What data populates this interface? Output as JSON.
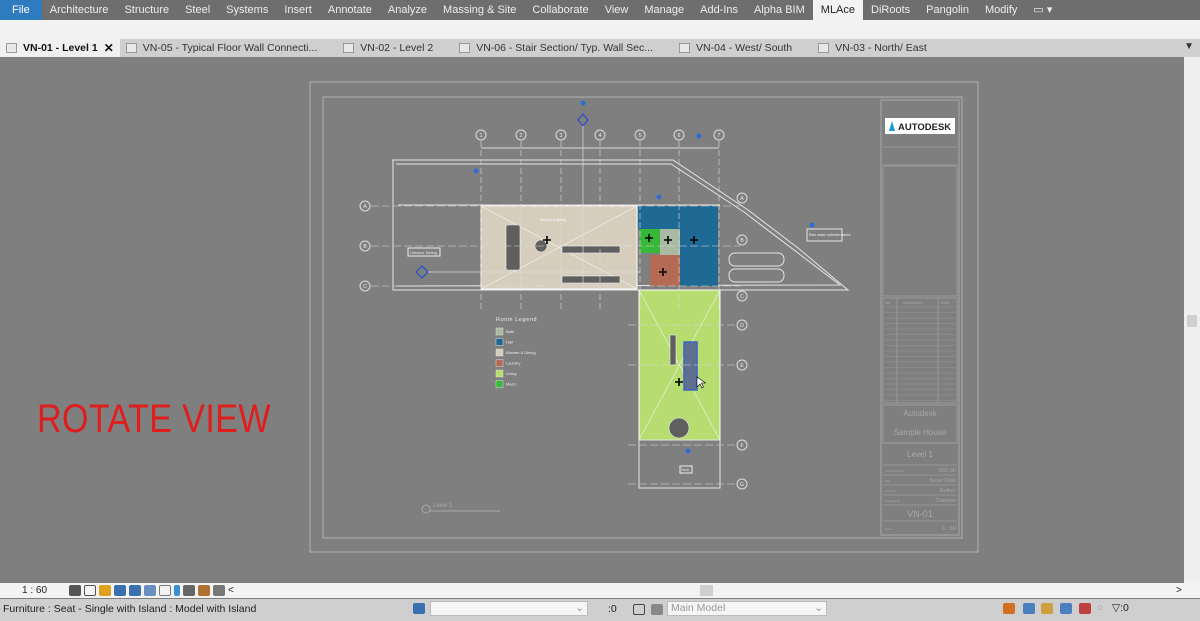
{
  "ribbon": {
    "tabs": [
      "File",
      "Architecture",
      "Structure",
      "Steel",
      "Systems",
      "Insert",
      "Annotate",
      "Analyze",
      "Massing & Site",
      "Collaborate",
      "View",
      "Manage",
      "Add-Ins",
      "Alpha BIM",
      "MLAce",
      "DiRoots",
      "Pangolin",
      "Modify"
    ],
    "active": "MLAce"
  },
  "view_tabs": [
    {
      "label": "VN-01 - Level 1",
      "active": true
    },
    {
      "label": "VN-05 - Typical Floor Wall Connecti..."
    },
    {
      "label": "VN-02 - Level 2"
    },
    {
      "label": "VN-06 - Stair Section/ Typ. Wall Sec..."
    },
    {
      "label": "VN-04 - West/ South"
    },
    {
      "label": "VN-03 - North/ East"
    }
  ],
  "overlay": {
    "text": "ROTATE VIEW",
    "color": "#e01d1d"
  },
  "drawing": {
    "grid_columns": [
      "1",
      "2",
      "3",
      "4",
      "5",
      "6",
      "7"
    ],
    "grid_rows": [
      "A",
      "B",
      "C",
      "D",
      "E",
      "F",
      "G"
    ],
    "labels": {
      "outdoor": "Outdoor Dining",
      "tanks": "Rain water collection tanks",
      "kitchen": "Kitchen & Dining",
      "level": "Level 1",
      "deck": "Deck"
    },
    "legend": {
      "title": "Room Legend",
      "items": [
        {
          "label": "Bath",
          "color": "#a9b9a2"
        },
        {
          "label": "Hall",
          "color": "#1f6a95"
        },
        {
          "label": "Kitchen & Dining",
          "color": "#d6cdbd"
        },
        {
          "label": "Laundry",
          "color": "#b46a55"
        },
        {
          "label": "Living",
          "color": "#b7dc6f"
        },
        {
          "label": "Mech.",
          "color": "#38b83a"
        }
      ]
    }
  },
  "title_block": {
    "logo": "AUTODESK",
    "company": "Autodesk",
    "project": "Sample House",
    "sheet_name": "Level 1",
    "project_number_label": "Project number",
    "project_number": "001-00",
    "date_label": "Date",
    "date": "Issue Date",
    "drawn_by_label": "Drawn by",
    "drawn_by": "Author",
    "checked_by_label": "Checked by",
    "checked_by": "Checker",
    "sheet_number": "VN-01",
    "scale_label": "Scale",
    "scale": "1 : 60",
    "revision_headers": [
      "No.",
      "Description",
      "Date"
    ]
  },
  "view_bar": {
    "scale": "1 : 60"
  },
  "status": {
    "selection": "Furniture : Seat - Single with Island : Model with Island",
    "workset_count": ":0",
    "model": "Main Model",
    "filter_count": ":0"
  }
}
